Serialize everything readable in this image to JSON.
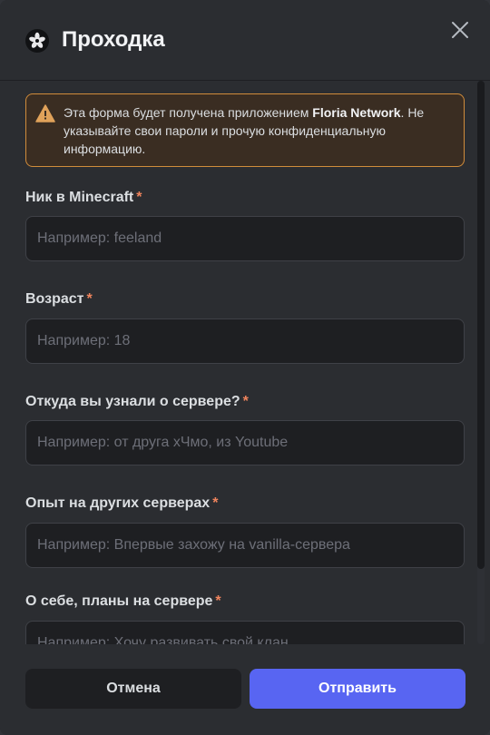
{
  "modal": {
    "title": "Проходка",
    "app_icon": "flower-icon",
    "close_icon": "close-icon"
  },
  "warning": {
    "icon": "warning-icon",
    "text_before": "Эта форма будет получена приложением ",
    "app_name": "Floria Network",
    "text_after": ". Не указывайте свои пароли и прочую конфиденциальную информацию."
  },
  "fields": [
    {
      "label": "Ник в Minecraft",
      "required": "*",
      "placeholder": "Например: feeland",
      "value": ""
    },
    {
      "label": "Возраст",
      "required": "*",
      "placeholder": "Например: 18",
      "value": ""
    },
    {
      "label": "Откуда вы узнали о сервере?",
      "required": "*",
      "placeholder": "Например: от друга хЧмо, из Youtube",
      "value": ""
    },
    {
      "label": "Опыт на других серверах",
      "required": "*",
      "placeholder": "Например: Впервые захожу на vanilla-сервера",
      "value": ""
    },
    {
      "label": "О себе, планы на сервере",
      "required": "*",
      "placeholder": "Например: Хочу развивать свой клан",
      "value": ""
    }
  ],
  "footer": {
    "cancel_label": "Отмена",
    "submit_label": "Отправить"
  },
  "colors": {
    "background": "#2b2d31",
    "accent": "#5865f2",
    "warning_border": "#d08c3b",
    "required_mark": "#f0845d"
  }
}
